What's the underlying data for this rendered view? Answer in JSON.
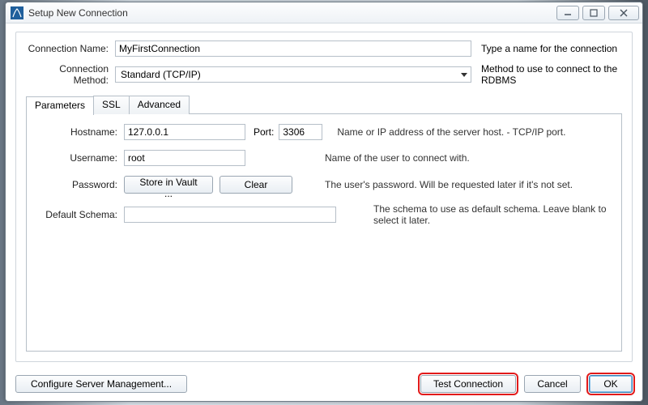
{
  "window": {
    "title": "Setup New Connection"
  },
  "form": {
    "connection_name_label": "Connection Name:",
    "connection_name_value": "MyFirstConnection",
    "connection_name_help": "Type a name for the connection",
    "connection_method_label": "Connection Method:",
    "connection_method_value": "Standard (TCP/IP)",
    "connection_method_help": "Method to use to connect to the RDBMS"
  },
  "tabs": {
    "parameters": "Parameters",
    "ssl": "SSL",
    "advanced": "Advanced"
  },
  "params": {
    "hostname_label": "Hostname:",
    "hostname_value": "127.0.0.1",
    "port_label": "Port:",
    "port_value": "3306",
    "hostport_help": "Name or IP address of the server host. - TCP/IP port.",
    "username_label": "Username:",
    "username_value": "root",
    "username_help": "Name of the user to connect with.",
    "password_label": "Password:",
    "store_btn": "Store in Vault ...",
    "clear_btn": "Clear",
    "password_help": "The user's password. Will be requested later if it's not set.",
    "schema_label": "Default Schema:",
    "schema_value": "",
    "schema_help": "The schema to use as default schema. Leave blank to select it later."
  },
  "footer": {
    "configure": "Configure Server Management...",
    "test": "Test Connection",
    "cancel": "Cancel",
    "ok": "OK"
  }
}
